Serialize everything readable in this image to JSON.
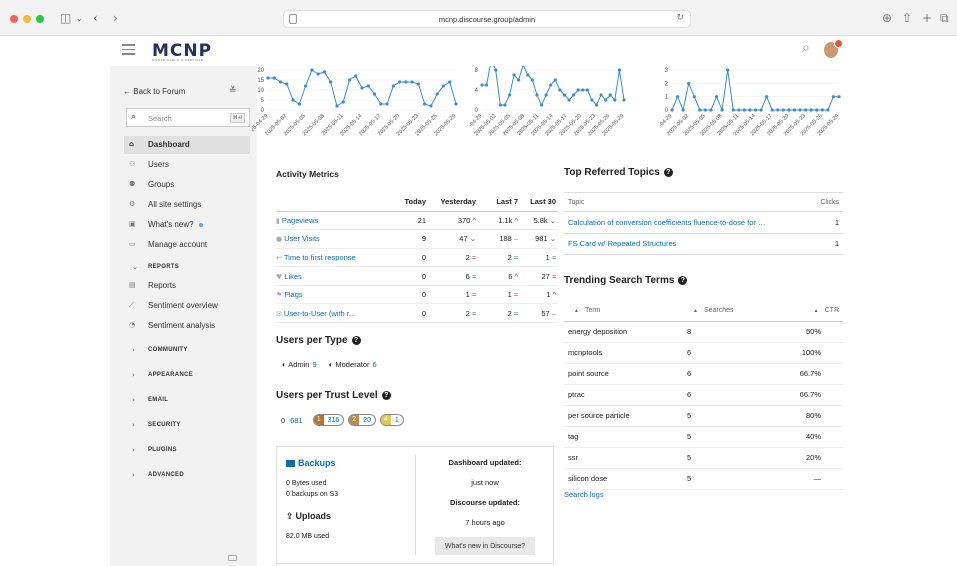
{
  "browser": {
    "url": "mcnp.discourse.group/admin"
  },
  "site": {
    "logo_text": "MCNP",
    "logo_sub": "MONTE CARLO N-PARTICLE"
  },
  "sidebar": {
    "back_label": "Back to Forum",
    "search_placeholder": "Search",
    "search_shortcut": "⌘+/",
    "items": [
      {
        "label": "Dashboard",
        "icon": "home-icon"
      },
      {
        "label": "Users",
        "icon": "users-icon"
      },
      {
        "label": "Groups",
        "icon": "groups-icon"
      },
      {
        "label": "All site settings",
        "icon": "gear-icon"
      },
      {
        "label": "What's new?",
        "icon": "gift-icon"
      },
      {
        "label": "Manage account",
        "icon": "credit-card-icon"
      }
    ],
    "reports_header": "REPORTS",
    "report_items": [
      {
        "label": "Reports",
        "icon": "chart-icon"
      },
      {
        "label": "Sentiment overview",
        "icon": "chart-line-icon"
      },
      {
        "label": "Sentiment analysis",
        "icon": "chart-pie-icon"
      }
    ],
    "sections": [
      "COMMUNITY",
      "APPEARANCE",
      "EMAIL",
      "SECURITY",
      "PLUGINS",
      "ADVANCED"
    ]
  },
  "mini_charts": {
    "dates": [
      "2025-04-29",
      "2025-05-02",
      "2025-05-05",
      "2025-05-08",
      "2025-05-11",
      "2025-05-14",
      "2025-05-17",
      "2025-05-20",
      "2025-05-23",
      "2025-05-26",
      "2025-05-29"
    ],
    "chart1": {
      "yticks": [
        "20",
        "15",
        "10",
        "5",
        "0"
      ],
      "values": [
        16,
        16,
        14,
        13,
        5,
        3,
        12,
        20,
        18,
        19,
        14,
        2,
        4,
        15,
        17,
        11,
        12,
        8,
        3,
        3,
        12,
        14,
        14,
        14,
        13,
        3,
        2,
        8,
        12,
        14,
        3
      ]
    },
    "chart2": {
      "yticks": [
        "8",
        "4",
        "0"
      ],
      "values": [
        5,
        5,
        10,
        8,
        1,
        1,
        3,
        7,
        6,
        9,
        7,
        6,
        3,
        1,
        3,
        5,
        6,
        4,
        3,
        2,
        3,
        4,
        4,
        4,
        2,
        1,
        3,
        2,
        3,
        2,
        8,
        2
      ]
    },
    "chart3": {
      "yticks": [
        "3",
        "2",
        "1",
        "0"
      ],
      "values": [
        0,
        1,
        0,
        2,
        1,
        0,
        0,
        0,
        1,
        0,
        3,
        0,
        0,
        0,
        0,
        0,
        0,
        1,
        0,
        0,
        0,
        0,
        0,
        0,
        0,
        0,
        0,
        0,
        0,
        1,
        1
      ]
    }
  },
  "activity": {
    "title": "Activity Metrics",
    "headers": [
      "",
      "Today",
      "Yesterday",
      "Last 7",
      "Last 30"
    ],
    "rows": [
      {
        "label": "Pageviews",
        "icon": "▮",
        "today": "21",
        "yesterday": "370",
        "yd": "up",
        "last7": "1.1k",
        "l7d": "up",
        "last30": "5.8k",
        "l30d": "down"
      },
      {
        "label": "User Visits",
        "icon": "●",
        "today": "9",
        "yesterday": "47",
        "yd": "down",
        "last7": "188",
        "l7d": "neutral",
        "last30": "981",
        "l30d": "down"
      },
      {
        "label": "Time to first response",
        "icon": "↩",
        "today": "0",
        "yesterday": "2",
        "yd": "down2",
        "last7": "2",
        "l7d": "up2",
        "last30": "1",
        "l30d": "up2"
      },
      {
        "label": "Likes",
        "icon": "♥",
        "today": "0",
        "yesterday": "6",
        "yd": "up2",
        "last7": "6",
        "l7d": "up",
        "last30": "27",
        "l30d": "down2"
      },
      {
        "label": "Flags",
        "icon": "⚑",
        "today": "0",
        "yesterday": "1",
        "yd": "down2",
        "last7": "1",
        "l7d": "down2",
        "last30": "1",
        "l30d": "up"
      },
      {
        "label": "User-to-User (with r...",
        "icon": "✉",
        "today": "0",
        "yesterday": "2",
        "yd": "up2",
        "last7": "2",
        "l7d": "up2",
        "last30": "57",
        "l30d": "neutral"
      }
    ]
  },
  "users_per_type": {
    "title": "Users per Type",
    "admin_label": "Admin",
    "admin_count": "9",
    "moderator_label": "Moderator",
    "moderator_count": "6"
  },
  "trust_levels": {
    "title": "Users per Trust Level",
    "levels": [
      {
        "level": "0",
        "count": "681",
        "color": ""
      },
      {
        "level": "1",
        "count": "316",
        "color": "#b87333"
      },
      {
        "level": "2",
        "count": "20",
        "color": "#b98b4e"
      },
      {
        "level": "4",
        "count": "1",
        "color": "#e8c64a"
      }
    ]
  },
  "backups": {
    "title": "Backups",
    "line1": "0 Bytes used",
    "line2": "0 backups on S3",
    "uploads_title": "Uploads",
    "uploads_line": "82.0 MB used",
    "dashboard_updated_label": "Dashboard updated:",
    "dashboard_updated_value": "just now",
    "discourse_updated_label": "Discourse updated:",
    "discourse_updated_value": "7 hours ago",
    "whats_new_button": "What's new in Discourse?"
  },
  "top_referred": {
    "title": "Top Referred Topics",
    "headers": [
      "Topic",
      "Clicks"
    ],
    "rows": [
      {
        "topic": "Calculation of conversion coefficients fluence-to-dose for …",
        "clicks": "1"
      },
      {
        "topic": "FS Card w/ Repeated Structures",
        "clicks": "1"
      }
    ]
  },
  "trending": {
    "title": "Trending Search Terms",
    "headers": [
      "Term",
      "Searches",
      "CTR"
    ],
    "rows": [
      {
        "term": "energy deposition",
        "searches": "8",
        "ctr": "50%"
      },
      {
        "term": "mcnptools",
        "searches": "6",
        "ctr": "100%"
      },
      {
        "term": "point source",
        "searches": "6",
        "ctr": "66.7%"
      },
      {
        "term": "ptrac",
        "searches": "6",
        "ctr": "66.7%"
      },
      {
        "term": "per source particle",
        "searches": "5",
        "ctr": "80%"
      },
      {
        "term": "tag",
        "searches": "5",
        "ctr": "40%"
      },
      {
        "term": "ssr",
        "searches": "5",
        "ctr": "20%"
      },
      {
        "term": "silicon dose",
        "searches": "5",
        "ctr": "—"
      }
    ],
    "search_logs_label": "Search logs"
  }
}
